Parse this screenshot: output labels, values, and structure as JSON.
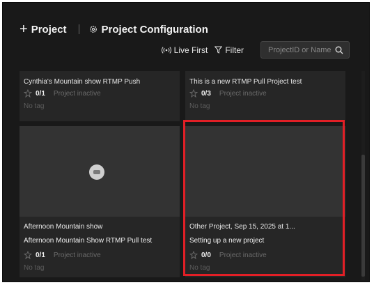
{
  "header": {
    "add_project_label": "Project",
    "configuration_label": "Project Configuration"
  },
  "toolbar": {
    "live_first_label": "Live First",
    "filter_label": "Filter",
    "search_placeholder": "ProjectID or Name"
  },
  "cards": [
    {
      "title": "Cynthia's Mountain show RTMP Push",
      "count": "0/1",
      "status": "Project inactive",
      "tag": "No tag"
    },
    {
      "title": "This is a new RTMP Pull Project test",
      "count": "0/3",
      "status": "Project inactive",
      "tag": "No tag"
    },
    {
      "title": "Afternoon Mountain show",
      "subtitle": "Afternoon Mountain Show RTMP Pull test",
      "count": "0/1",
      "status": "Project inactive",
      "tag": "No tag"
    },
    {
      "title": "Other Project, Sep 15, 2025 at 1...",
      "subtitle": "Setting up a new project",
      "count": "0/0",
      "status": "Project inactive",
      "tag": "No tag",
      "highlighted": true
    }
  ],
  "colors": {
    "background": "#191919",
    "card": "#262626",
    "thumbnail": "#333333",
    "highlight": "#e21f26"
  }
}
